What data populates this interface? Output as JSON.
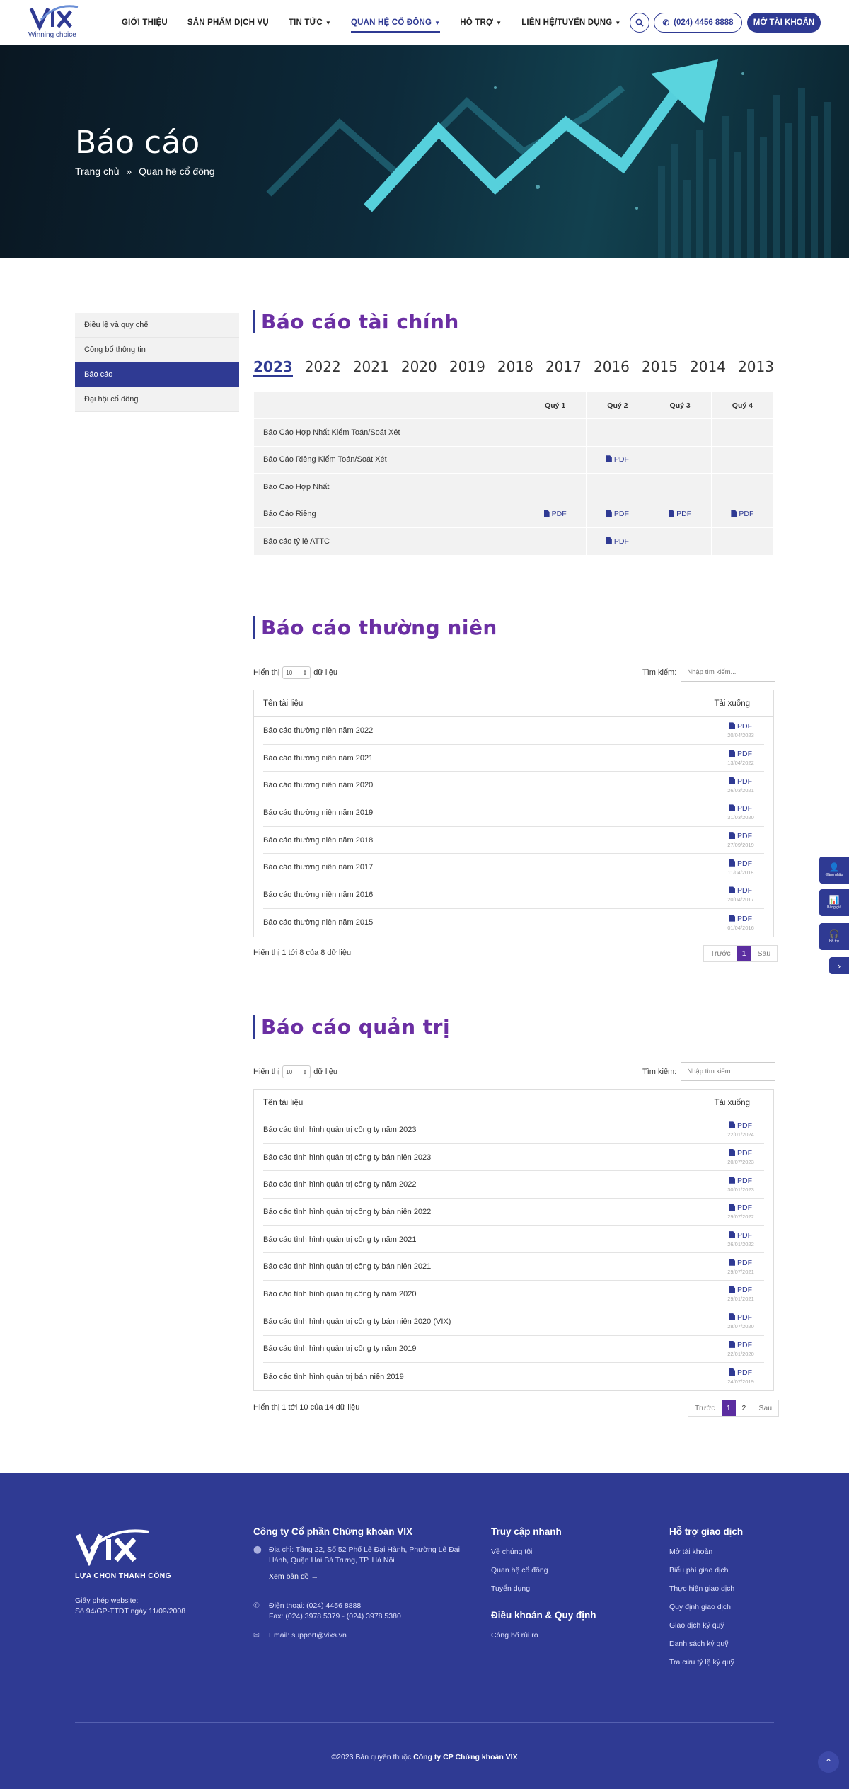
{
  "header": {
    "logo_text": "VIX",
    "logo_tagline": "Winning choice",
    "nav": [
      {
        "label": "GIỚI THIỆU",
        "dropdown": false
      },
      {
        "label": "SẢN PHẨM DỊCH VỤ",
        "dropdown": false
      },
      {
        "label": "TIN TỨC",
        "dropdown": true
      },
      {
        "label": "QUAN HỆ CỔ ĐÔNG",
        "dropdown": true
      },
      {
        "label": "HỖ TRỢ",
        "dropdown": true
      },
      {
        "label": "LIÊN HỆ/TUYỂN DỤNG",
        "dropdown": true
      }
    ],
    "phone": "(024) 4456 8888",
    "open_account": "MỞ TÀI KHOẢN"
  },
  "hero": {
    "title": "Báo cáo",
    "breadcrumb": [
      "Trang chủ",
      "»",
      "Quan hệ cổ đông"
    ]
  },
  "sidebar": [
    {
      "label": "Điều lệ và quy chế",
      "active": false
    },
    {
      "label": "Công bố thông tin",
      "active": false
    },
    {
      "label": "Báo cáo",
      "active": true
    },
    {
      "label": "Đại hội cổ đông",
      "active": false
    }
  ],
  "financial": {
    "title": "Báo cáo tài chính",
    "years": [
      "2023",
      "2022",
      "2021",
      "2020",
      "2019",
      "2018",
      "2017",
      "2016",
      "2015",
      "2014",
      "2013"
    ],
    "active_year": "2023",
    "columns": [
      "",
      "Quý 1",
      "Quý 2",
      "Quý 3",
      "Quý 4"
    ],
    "pdf_label": "PDF",
    "rows": [
      {
        "name": "Báo Cáo Hợp Nhất Kiểm Toán/Soát Xét",
        "q": [
          "",
          "",
          "",
          ""
        ]
      },
      {
        "name": "Báo Cáo Riêng Kiểm Toán/Soát Xét",
        "q": [
          "",
          "PDF",
          "",
          ""
        ]
      },
      {
        "name": "Báo Cáo Hợp Nhất",
        "q": [
          "",
          "",
          "",
          ""
        ]
      },
      {
        "name": "Báo Cáo Riêng",
        "q": [
          "PDF",
          "PDF",
          "PDF",
          "PDF"
        ]
      },
      {
        "name": "Báo cáo tỷ lệ ATTC",
        "q": [
          "",
          "PDF",
          "",
          ""
        ]
      }
    ]
  },
  "annual": {
    "title": "Báo cáo thường niên",
    "length_prefix": "Hiển thị",
    "length_value": "10",
    "length_suffix": "dữ liệu",
    "search_label": "Tìm kiếm:",
    "search_placeholder": "Nhập tìm kiếm...",
    "col_name": "Tên tài liệu",
    "col_download": "Tải xuống",
    "rows": [
      {
        "name": "Báo cáo thường niên năm 2022",
        "pdf": "PDF",
        "date": "20/04/2023"
      },
      {
        "name": "Báo cáo thường niên năm 2021",
        "pdf": "PDF",
        "date": "13/04/2022"
      },
      {
        "name": "Báo cáo thường niên năm 2020",
        "pdf": "PDF",
        "date": "26/03/2021"
      },
      {
        "name": "Báo cáo thường niên năm 2019",
        "pdf": "PDF",
        "date": "31/03/2020"
      },
      {
        "name": "Báo cáo thường niên năm 2018",
        "pdf": "PDF",
        "date": "27/09/2019"
      },
      {
        "name": "Báo cáo thường niên năm 2017",
        "pdf": "PDF",
        "date": "11/04/2018"
      },
      {
        "name": "Báo cáo thường niên năm 2016",
        "pdf": "PDF",
        "date": "20/04/2017"
      },
      {
        "name": "Báo cáo thường niên năm 2015",
        "pdf": "PDF",
        "date": "01/04/2016"
      }
    ],
    "info": "Hiển thị 1 tới 8 của 8 dữ liệu",
    "pager": [
      "Trước",
      "1",
      "Sau"
    ]
  },
  "governance": {
    "title": "Báo cáo quản trị",
    "length_prefix": "Hiển thị",
    "length_value": "10",
    "length_suffix": "dữ liệu",
    "search_label": "Tìm kiếm:",
    "search_placeholder": "Nhập tìm kiếm...",
    "col_name": "Tên tài liệu",
    "col_download": "Tải xuống",
    "rows": [
      {
        "name": "Báo cáo tình hình quản trị công ty năm 2023",
        "pdf": "PDF",
        "date": "22/01/2024"
      },
      {
        "name": "Báo cáo tình hình quản trị công ty bán niên 2023",
        "pdf": "PDF",
        "date": "20/07/2023"
      },
      {
        "name": "Báo cáo tình hình quản trị công ty năm 2022",
        "pdf": "PDF",
        "date": "30/01/2023"
      },
      {
        "name": "Báo cáo tình hình quản trị công ty bán niên 2022",
        "pdf": "PDF",
        "date": "29/07/2022"
      },
      {
        "name": "Báo cáo tình hình quản trị công ty năm 2021",
        "pdf": "PDF",
        "date": "26/01/2022"
      },
      {
        "name": "Báo cáo tình hình quản trị công ty bán niên 2021",
        "pdf": "PDF",
        "date": "29/07/2021"
      },
      {
        "name": "Báo cáo tình hình quản trị công ty năm 2020",
        "pdf": "PDF",
        "date": "29/01/2021"
      },
      {
        "name": "Báo cáo tình hình quản trị công ty bán niên 2020 (VIX)",
        "pdf": "PDF",
        "date": "28/07/2020"
      },
      {
        "name": "Báo cáo tình hình quản trị công ty năm 2019",
        "pdf": "PDF",
        "date": "22/01/2020"
      },
      {
        "name": "Báo cáo tình hình quản trị bán niên 2019",
        "pdf": "PDF",
        "date": "24/07/2019"
      }
    ],
    "info": "Hiển thị 1 tới 10 của 14 dữ liệu",
    "pager": [
      "Trước",
      "1",
      "2",
      "Sau"
    ]
  },
  "floating": [
    {
      "label": "Đăng nhập",
      "icon": "user-icon"
    },
    {
      "label": "Bảng giá",
      "icon": "chart-icon"
    },
    {
      "label": "Hỗ trợ",
      "icon": "headset-icon"
    }
  ],
  "footer": {
    "logo_text": "VIX",
    "slogan": "LỰA CHỌN THÀNH CÔNG",
    "license_label": "Giấy phép website:",
    "license_value": "Số 94/GP-TTĐT ngày 11/09/2008",
    "company": "Công ty Cổ phần Chứng khoán VIX",
    "address": "Địa chỉ: Tầng 22, Số 52 Phố Lê Đại Hành, Phường Lê Đại Hành, Quận Hai Bà Trưng, TP. Hà Nội",
    "map_link": "Xem bản đồ",
    "phone": "Điện thoại: (024) 4456 8888",
    "fax": "Fax: (024) 3978 5379 - (024) 3978 5380",
    "email": "Email: support@vixs.vn",
    "quick_title": "Truy cập nhanh",
    "quick_links": [
      "Về chúng tôi",
      "Quan hệ cổ đông",
      "Tuyển dụng"
    ],
    "terms_title": "Điều khoản & Quy định",
    "terms_links": [
      "Công bố rủi ro"
    ],
    "support_title": "Hỗ trợ giao dịch",
    "support_links": [
      "Mở tài khoản",
      "Biểu phí giao dịch",
      "Thực hiện giao dịch",
      "Quy định giao dịch",
      "Giao dịch ký quỹ",
      "Danh sách ký quỹ",
      "Tra cứu tỷ lệ ký quỹ"
    ],
    "copyright_prefix": "©2023 Bản quyền thuộc",
    "copyright_company": "Công ty CP Chứng khoán VIX"
  },
  "colors": {
    "primary": "#2f3a93",
    "accent_purple": "#6b2fa3",
    "pager_active": "#5b2da0"
  }
}
